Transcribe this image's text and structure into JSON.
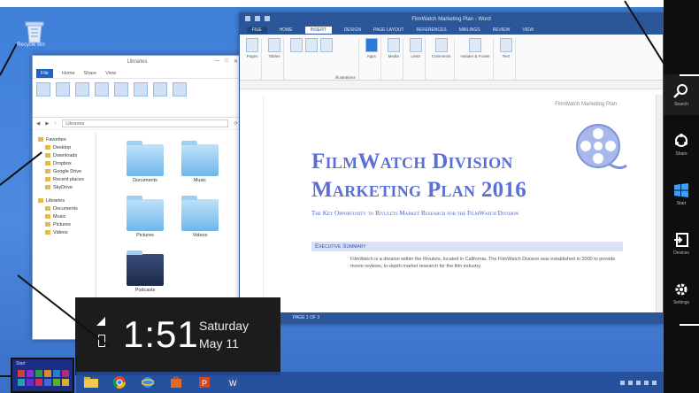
{
  "desktop": {
    "recycle_bin_label": "Recycle Bin"
  },
  "explorer": {
    "title": "Libraries",
    "tabs": [
      "File",
      "Home",
      "Share",
      "View"
    ],
    "address": "Libraries",
    "nav_items": [
      {
        "label": "Favorites",
        "sub": false
      },
      {
        "label": "Desktop",
        "sub": true
      },
      {
        "label": "Downloads",
        "sub": true
      },
      {
        "label": "Dropbox",
        "sub": true
      },
      {
        "label": "Google Drive",
        "sub": true
      },
      {
        "label": "Recent places",
        "sub": true
      },
      {
        "label": "SkyDrive",
        "sub": true
      },
      {
        "label": "Libraries",
        "sub": false
      },
      {
        "label": "Documents",
        "sub": true
      },
      {
        "label": "Music",
        "sub": true
      },
      {
        "label": "Pictures",
        "sub": true
      },
      {
        "label": "Videos",
        "sub": true
      }
    ],
    "folders": [
      "Documents",
      "Music",
      "Pictures",
      "Videos",
      "Podcasts"
    ]
  },
  "word": {
    "title": "FilmWatch Marketing Plan - Word",
    "tabs": [
      "FILE",
      "HOME",
      "INSERT",
      "DESIGN",
      "PAGE LAYOUT",
      "REFERENCES",
      "MAILINGS",
      "REVIEW",
      "VIEW"
    ],
    "ribbon_groups": [
      "Pages",
      "Tables",
      "Illustrations",
      "Apps",
      "Media",
      "Links",
      "Comments",
      "Header & Footer",
      "Text"
    ],
    "page_header": "FilmWatch Marketing Plan",
    "title_line1": "FilmWatch Division",
    "title_line2": "Marketing Plan 2016",
    "subtitle": "The Key Opportunity to Rivulets Market Research for the FilmWatch Division",
    "section_heading": "Executive Summary",
    "paragraph": "FilmWatch is a division within the Rivulets, located in California. The FilmWatch Division was established in 2000 to provide movie reviews, in-depth market research for the film industry.",
    "status": "PAGE 1 OF 3"
  },
  "clock": {
    "time": "1:51",
    "day": "Saturday",
    "date": "May 11"
  },
  "taskbar": {
    "apps": [
      "file-explorer",
      "chrome",
      "internet-explorer",
      "store",
      "powerpoint",
      "word"
    ]
  },
  "start_thumb": {
    "label": "Start"
  },
  "charms": {
    "items": [
      {
        "label": "Search",
        "icon": "search-icon"
      },
      {
        "label": "Share",
        "icon": "share-icon"
      },
      {
        "label": "Start",
        "icon": "windows-icon"
      },
      {
        "label": "Devices",
        "icon": "devices-icon"
      },
      {
        "label": "Settings",
        "icon": "settings-icon"
      }
    ]
  },
  "colors": {
    "word_blue": "#2b579a",
    "title_blue": "#5b6fd6",
    "desktop_blue": "#3f7fd8"
  }
}
